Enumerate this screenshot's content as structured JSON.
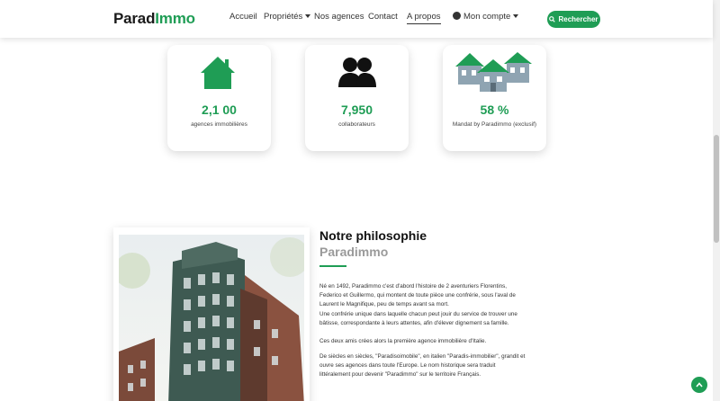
{
  "navbar": {
    "brand_part1": "Parad",
    "brand_part2": "Immo",
    "items": [
      {
        "label": "Accueil"
      },
      {
        "label": "Propriétés"
      },
      {
        "label": "Nos agences"
      },
      {
        "label": "Contact"
      },
      {
        "label": "A propos"
      },
      {
        "label": "Mon compte"
      }
    ],
    "search_label": "Rechercher"
  },
  "stats": [
    {
      "value": "2,1 00",
      "label": "agences immobilières",
      "icon": "house-icon"
    },
    {
      "value": "7,950",
      "label": "collaborateurs",
      "icon": "users-icon"
    },
    {
      "value": "58 %",
      "label": "Mandat by Paradimmo (exclusif)",
      "icon": "houses-icon"
    }
  ],
  "philosophy": {
    "title": "Notre philosophie",
    "subtitle": "Paradimmo",
    "paragraph1": "Né en 1492, Paradimmo c'est d'abord l'histoire de 2 aventuriers Florentins, Federico et Guillermo, qui montent de toute pièce une confrérie, sous l'aval de Laurent le Magnifique, peu de temps avant sa mort.",
    "paragraph2": "Une confrérie unique dans laquelle chacun peut jouir du service de trouver une bâtisse, correspondante à leurs attentes, afin d'élever dignement sa famille.",
    "paragraph3": "Ces deux amis crées alors la première agence immobilière d'Italie.",
    "paragraph4": "De siècles en siècles, \"Paradisoimobile\", en italien \"Paradis-immobilier\", grandit et ouvre ses agences dans toute l'Europe. Le nom historique sera traduit littéralement pour devenir \"Paradimmo\" sur le territoire Français."
  },
  "colors": {
    "accent": "#1f9d55"
  }
}
